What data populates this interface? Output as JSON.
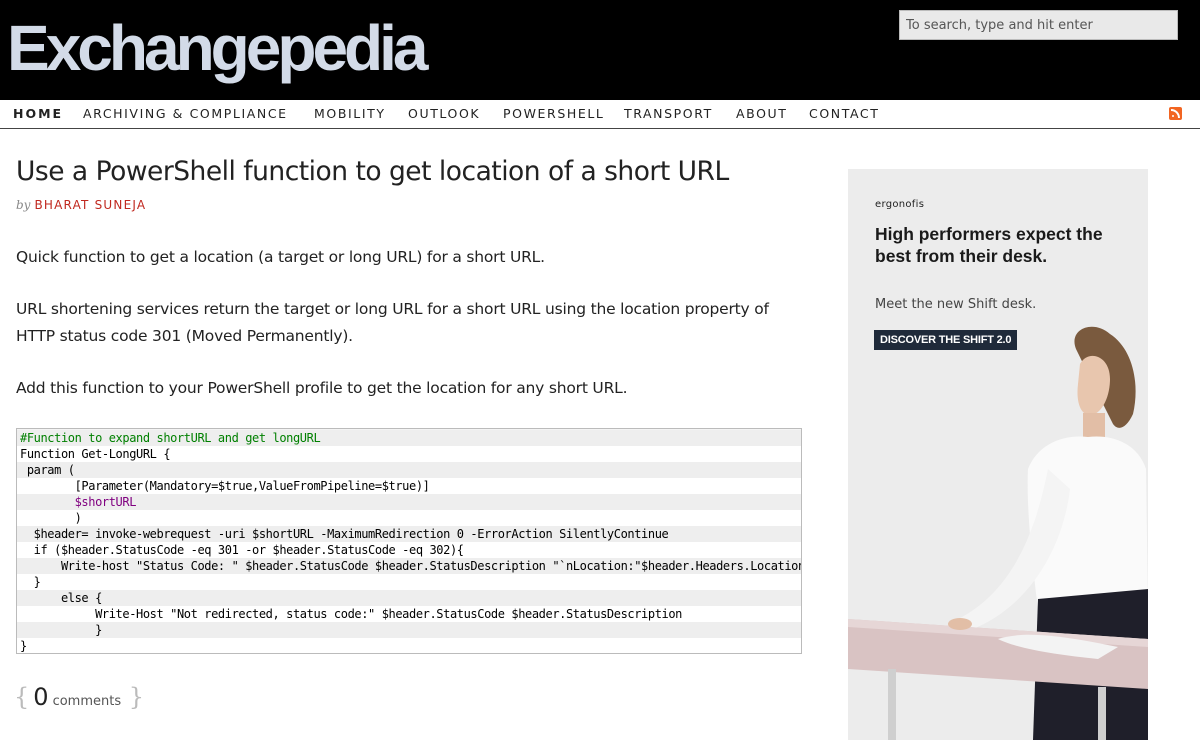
{
  "site": {
    "logo": "Exchangepedia"
  },
  "search": {
    "placeholder": "To search, type and hit enter"
  },
  "nav": {
    "items": [
      {
        "label": "HOME"
      },
      {
        "label": "ARCHIVING & COMPLIANCE"
      },
      {
        "label": "MOBILITY"
      },
      {
        "label": "OUTLOOK"
      },
      {
        "label": "POWERSHELL"
      },
      {
        "label": "TRANSPORT"
      },
      {
        "label": "ABOUT"
      },
      {
        "label": "CONTACT"
      }
    ],
    "rss_icon": "rss-icon"
  },
  "article": {
    "title": "Use a PowerShell function to get location of a short URL",
    "by": "by",
    "author": "BHARAT SUNEJA",
    "paragraphs": [
      "Quick function to get a location (a target or long URL) for a short URL.",
      "URL shortening services return the target or long URL for a short URL using the location property of HTTP status code 301 (Moved Permanently).",
      "Add this function to your PowerShell profile to get the location for any short URL."
    ],
    "code_lines": [
      "#Function to expand shortURL and get longURL",
      "Function Get-LongURL {",
      " param (",
      "        [Parameter(Mandatory=$true,ValueFromPipeline=$true)]",
      "        $shortURL",
      "        )",
      "  $header= invoke-webrequest -uri $shortURL -MaximumRedirection 0 -ErrorAction SilentlyContinue",
      "  if ($header.StatusCode -eq 301 -or $header.StatusCode -eq 302){",
      "      Write-host \"Status Code: \" $header.StatusCode $header.StatusDescription \"`nLocation:\"$header.Headers.Location",
      "  }",
      "      else {",
      "           Write-Host \"Not redirected, status code:\" $header.StatusCode $header.StatusDescription",
      "           }",
      "}"
    ],
    "comments": {
      "count": "0",
      "label": "comments"
    }
  },
  "ad": {
    "brand": "ergonofis",
    "headline": "High performers expect the best from their desk.",
    "sub": "Meet the new Shift desk.",
    "cta": "DISCOVER THE SHIFT 2.0"
  },
  "colors": {
    "header_bg": "#000000",
    "logo": "#d3dbe8",
    "author": "#c0281f",
    "cta_bg": "#1f2a3a",
    "rss": "#f26522"
  }
}
